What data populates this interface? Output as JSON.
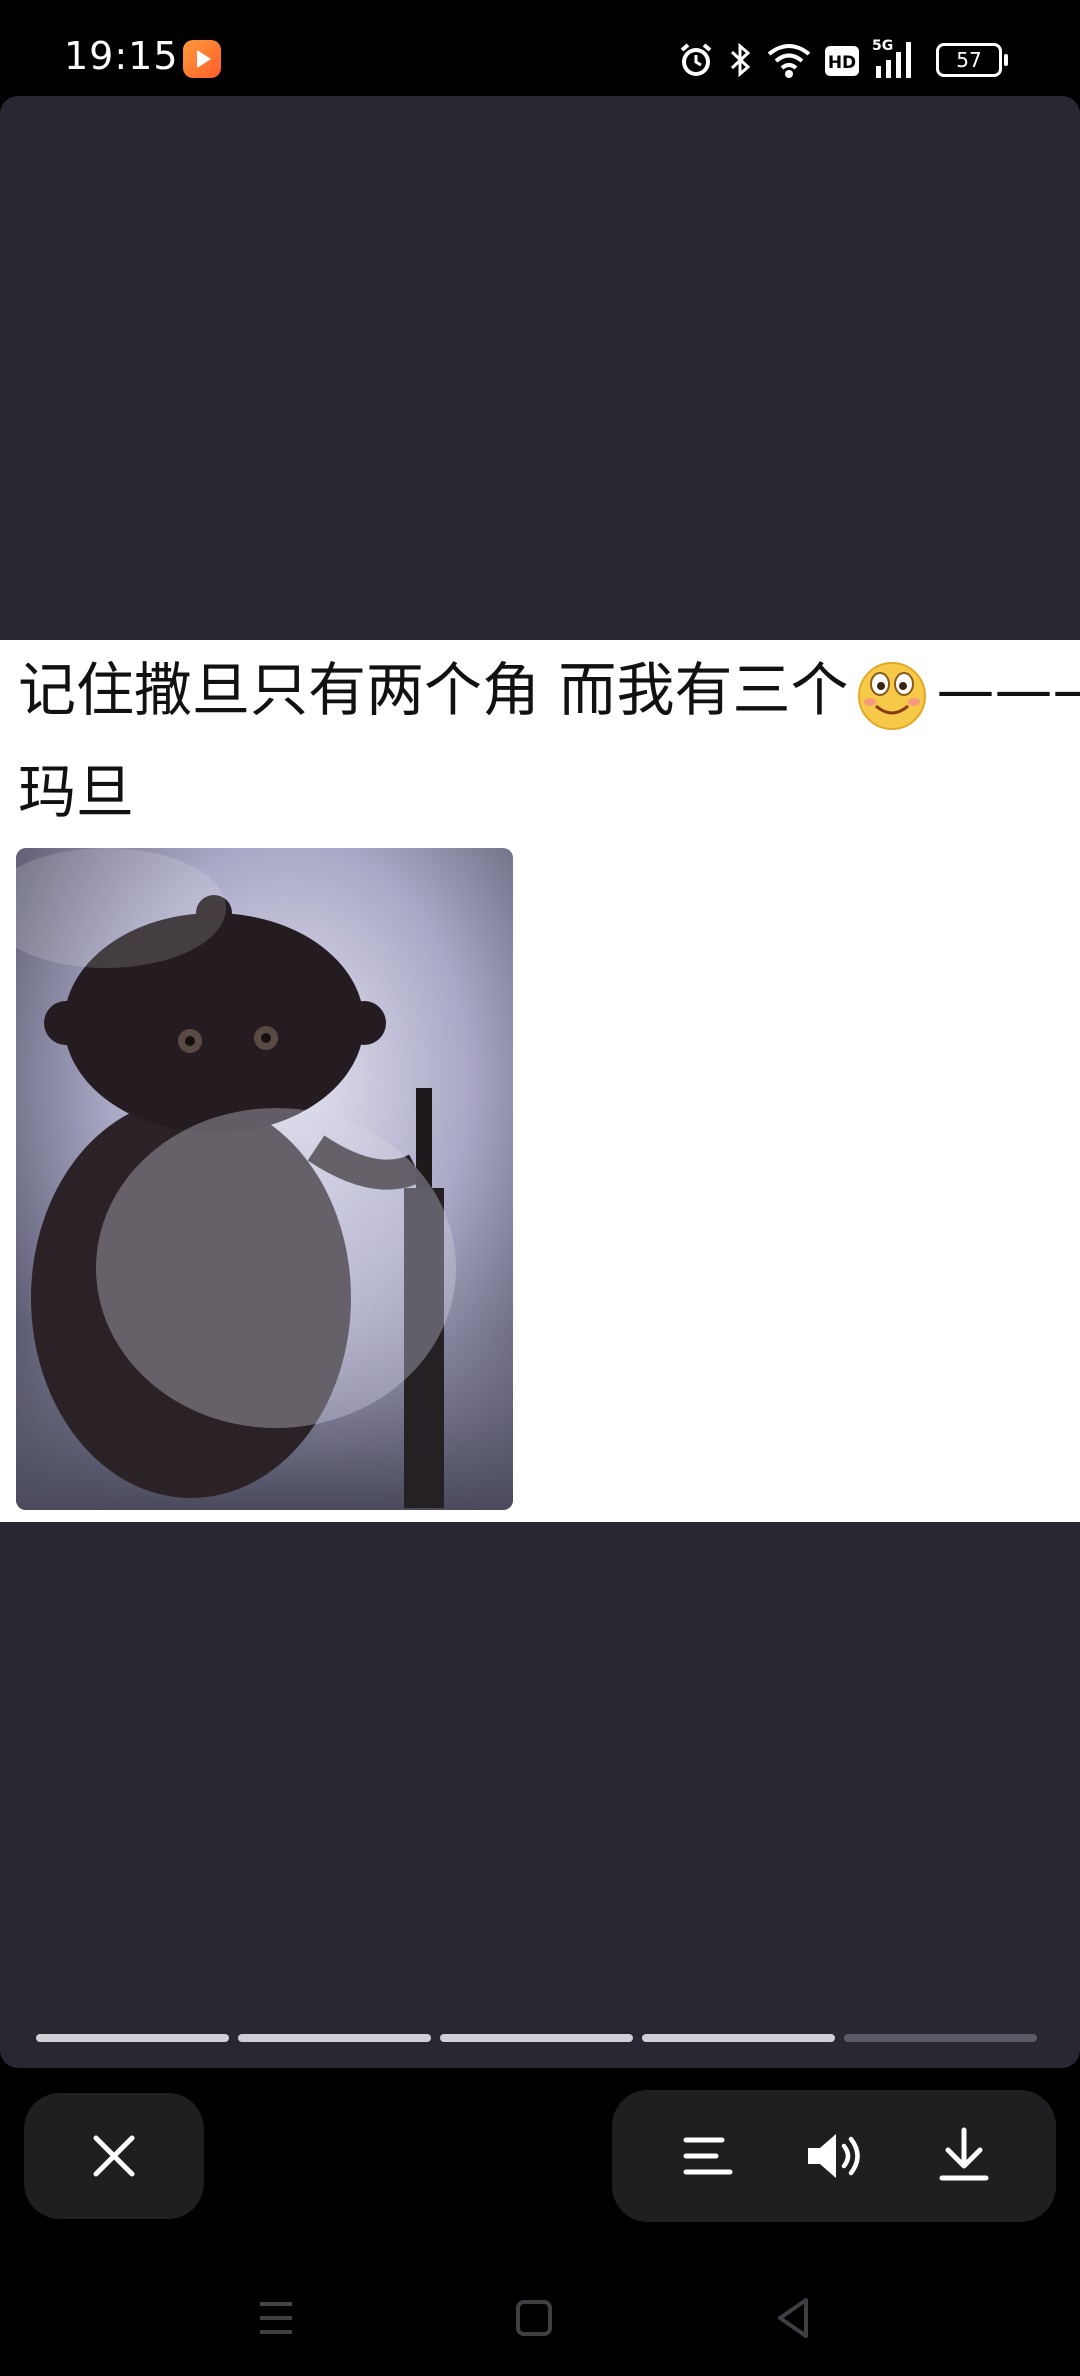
{
  "status_bar": {
    "time": "19:15",
    "battery": "57",
    "icons": [
      "app-notification-icon",
      "alarm-icon",
      "bluetooth-icon",
      "wifi-icon",
      "hd-icon",
      "signal-5g-icon",
      "battery-icon"
    ]
  },
  "post": {
    "line1": "记住撒旦只有两个角 而我有三个",
    "line1_suffix": "———",
    "line2": "玛旦",
    "emoji": "smiling-face-emoji"
  },
  "progress": {
    "segments": 5,
    "viewed": 4
  },
  "controls": {
    "close": "close-icon",
    "actions": [
      "menu-icon",
      "volume-icon",
      "download-icon"
    ]
  },
  "navigation": [
    "recent-apps-icon",
    "home-icon",
    "back-icon"
  ]
}
